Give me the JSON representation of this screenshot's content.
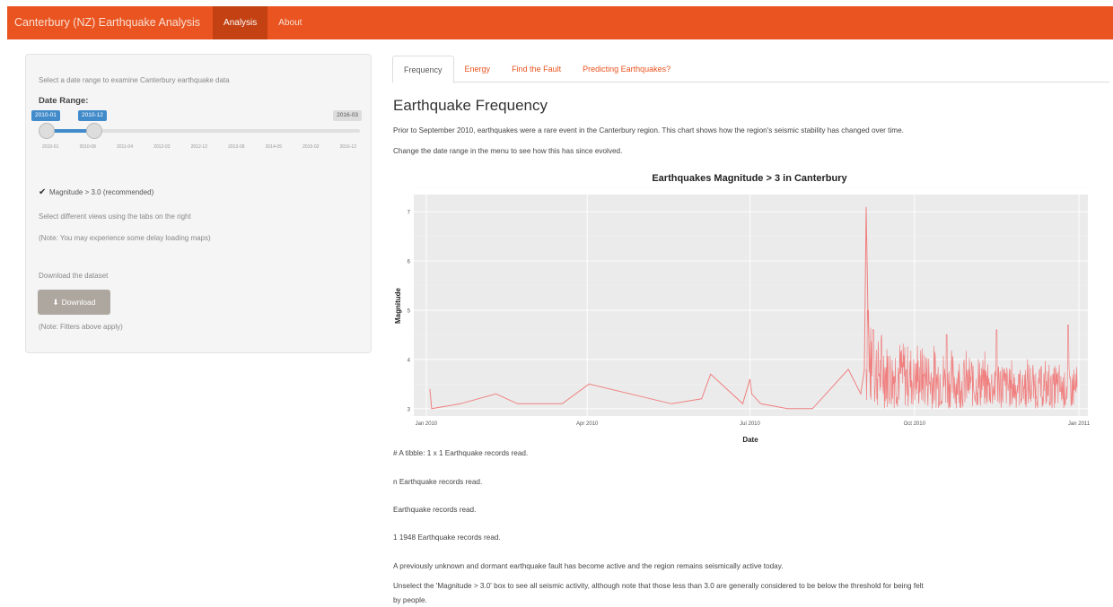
{
  "navbar": {
    "brand": "Canterbury (NZ) Earthquake Analysis",
    "items": [
      "Analysis",
      "About"
    ],
    "accent": "#e95420"
  },
  "sidebar": {
    "intro": "Select a date range to examine Canterbury earthquake data",
    "date_label": "Date Range:",
    "slider": {
      "from": "2010-01",
      "to": "2010-12",
      "max": "2016-03",
      "ticks": [
        "2010-01",
        "2010-08",
        "2011-04",
        "2012-03",
        "2012-12",
        "2013-08",
        "2014-05",
        "2015-02",
        "2016-12"
      ]
    },
    "checkbox_label": "Magnitude > 3.0 (recommended)",
    "checkbox_checked": true,
    "tabs_note": "Select different views using the tabs on the right",
    "delay_note": "(Note: You may experience some delay loading maps)",
    "download_heading": "Download the dataset",
    "download_button": "Download",
    "filters_note": "(Note: Filters above apply)"
  },
  "tabs": [
    "Frequency",
    "Energy",
    "Find the Fault",
    "Predicting Earthquakes?"
  ],
  "main": {
    "title": "Earthquake Frequency",
    "para1": "Prior to September 2010, earthquakes were a rare event in the Canterbury region. This chart shows how the region's seismic stability has changed over time.",
    "para2": "Change the date range in the menu to see how this has since evolved.",
    "out1": "# A tibble: 1 x 1 Earthquake records read.",
    "out2": "n Earthquake records read.",
    "out3": "Earthquake records read.",
    "out4": "1 1948 Earthquake records read.",
    "para3": "A previously unknown and dormant earthquake fault has become active and the region remains seismically active today.",
    "para4a": "Unselect the 'Magnitude > 3.0' box to see all seismic activity, although note that those less than 3.0 are generally considered to be below the threshold for being felt",
    "para4b": "by people."
  },
  "chart_data": {
    "type": "line",
    "title": "Earthquakes Magnitude > 3 in Canterbury",
    "xlabel": "Date",
    "ylabel": "Magnitude",
    "x_ticks": [
      "Jan 2010",
      "Apr 2010",
      "Jul 2010",
      "Oct 2010",
      "Jan 2011"
    ],
    "y_ticks": [
      3,
      4,
      5,
      6,
      7
    ],
    "ylim": [
      2.85,
      7.35
    ],
    "xlim": [
      "2009-12-25",
      "2011-01-06"
    ],
    "grid": true,
    "color": "#f08080",
    "series": [
      {
        "x": [
          "2010-01-03",
          "2010-01-04",
          "2010-01-20",
          "2010-02-09",
          "2010-02-21",
          "2010-03-18",
          "2010-04-02",
          "2010-05-18",
          "2010-06-04",
          "2010-06-09",
          "2010-06-27",
          "2010-07-01",
          "2010-07-02",
          "2010-07-07",
          "2010-07-22",
          "2010-08-05",
          "2010-08-25",
          "2010-09-01",
          "2010-09-03",
          "2010-09-04",
          "2010-09-05",
          "2010-09-06"
        ],
        "y": [
          3.4,
          3.0,
          3.1,
          3.3,
          3.1,
          3.1,
          3.5,
          3.1,
          3.2,
          3.7,
          3.1,
          3.6,
          3.3,
          3.1,
          3.0,
          3.0,
          3.8,
          3.3,
          3.8,
          7.1,
          4.9,
          3.9
        ]
      }
    ],
    "aftershock_range": [
      "2010-09-04",
      "2010-12-31"
    ],
    "aftershock_band": [
      3.0,
      4.4
    ],
    "aftershock_peaks": [
      {
        "x": "2010-09-05",
        "y": 5.0
      },
      {
        "x": "2010-09-08",
        "y": 4.6
      },
      {
        "x": "2010-10-19",
        "y": 4.5
      },
      {
        "x": "2010-12-26",
        "y": 4.7
      },
      {
        "x": "2010-11-16",
        "y": 4.6
      }
    ]
  }
}
